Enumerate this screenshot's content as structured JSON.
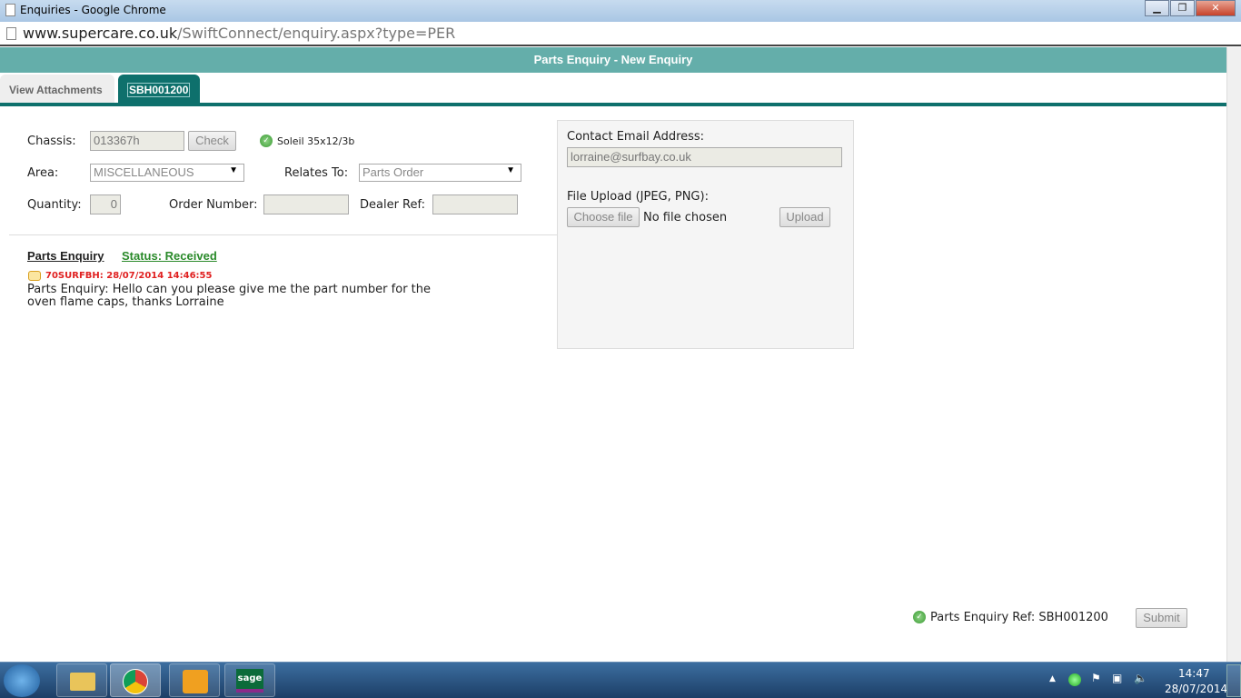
{
  "window": {
    "title": "Enquiries - Google Chrome",
    "minimize": "▁",
    "maximize": "❐",
    "close": "✕"
  },
  "address": {
    "domain": "www.supercare.co.uk",
    "path": "/SwiftConnect/enquiry.aspx?type=PER"
  },
  "header": {
    "title": "Parts Enquiry - New Enquiry"
  },
  "tabs": [
    {
      "label": "View Attachments"
    },
    {
      "label": "SBH001200"
    }
  ],
  "form": {
    "chassis_label": "Chassis:",
    "chassis_value": "013367h",
    "check_label": "Check",
    "chassis_result": "Soleil 35x12/3b",
    "area_label": "Area:",
    "area_value": "MISCELLANEOUS",
    "relates_label": "Relates To:",
    "relates_value": "Parts Order",
    "quantity_label": "Quantity:",
    "quantity_value": "0",
    "order_label": "Order Number:",
    "order_value": "",
    "dealer_label": "Dealer Ref:",
    "dealer_value": ""
  },
  "enquiry": {
    "title": "Parts Enquiry",
    "status": "Status: Received",
    "author_time": "70SURFBH: 28/07/2014 14:46:55",
    "line1": "Parts Enquiry: Hello can you please give me the part number for the",
    "line2": "oven flame caps, thanks Lorraine"
  },
  "contact": {
    "email_label": "Contact Email Address:",
    "email_value": "lorraine@surfbay.co.uk",
    "upload_label": "File Upload (JPEG, PNG):",
    "choose_label": "Choose file",
    "no_file": "No file chosen",
    "upload_button": "Upload"
  },
  "footer": {
    "ref": "Parts Enquiry Ref: SBH001200",
    "submit": "Submit"
  },
  "taskbar": {
    "time": "14:47",
    "date": "28/07/2014",
    "apps": [
      "explorer",
      "chrome",
      "outlook",
      "sage"
    ],
    "sage_label": "sage"
  },
  "colors": {
    "header": "#64aeaa",
    "tab_active": "#0e706c",
    "status": "#2a8a2a",
    "author": "#e02020"
  }
}
